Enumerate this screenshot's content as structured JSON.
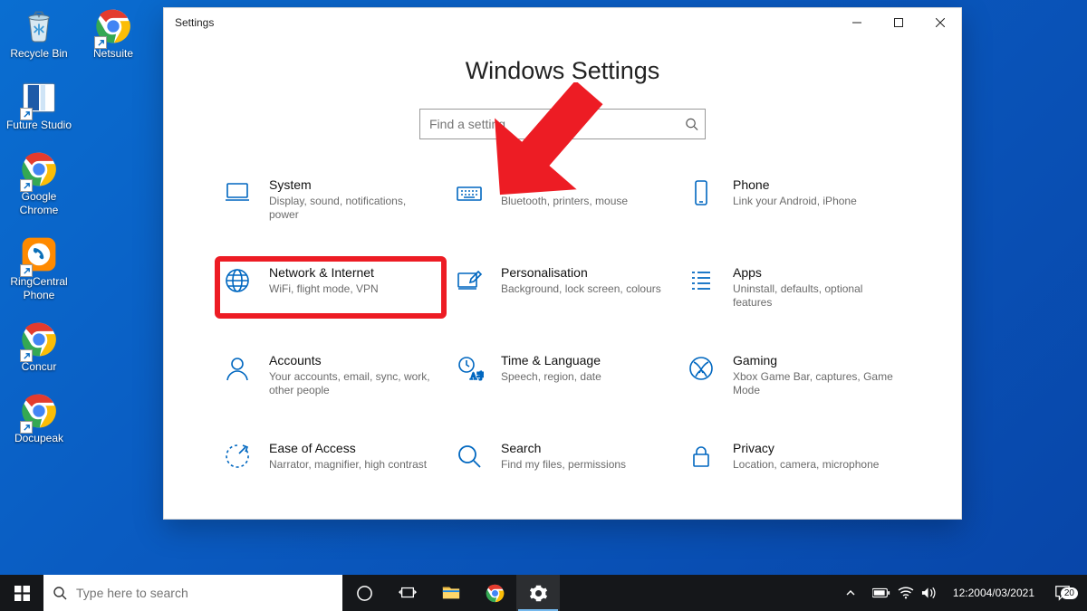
{
  "desktop": {
    "icons": [
      {
        "id": "recycle-bin",
        "label": "Recycle Bin"
      },
      {
        "id": "netsuite",
        "label": "Netsuite"
      },
      {
        "id": "future-studio",
        "label": "Future Studio"
      },
      {
        "id": "google-chrome",
        "label": "Google Chrome"
      },
      {
        "id": "ringcentral-phone",
        "label": "RingCentral Phone"
      },
      {
        "id": "concur",
        "label": "Concur"
      },
      {
        "id": "docupeak",
        "label": "Docupeak"
      }
    ]
  },
  "window": {
    "title": "Settings",
    "page_title": "Windows Settings",
    "search_placeholder": "Find a setting"
  },
  "categories": [
    {
      "id": "system",
      "title": "System",
      "sub": "Display, sound, notifications, power"
    },
    {
      "id": "devices",
      "title": "Devices",
      "sub": "Bluetooth, printers, mouse"
    },
    {
      "id": "phone",
      "title": "Phone",
      "sub": "Link your Android, iPhone"
    },
    {
      "id": "network",
      "title": "Network & Internet",
      "sub": "WiFi, flight mode, VPN"
    },
    {
      "id": "personalisation",
      "title": "Personalisation",
      "sub": "Background, lock screen, colours"
    },
    {
      "id": "apps",
      "title": "Apps",
      "sub": "Uninstall, defaults, optional features"
    },
    {
      "id": "accounts",
      "title": "Accounts",
      "sub": "Your accounts, email, sync, work, other people"
    },
    {
      "id": "time",
      "title": "Time & Language",
      "sub": "Speech, region, date"
    },
    {
      "id": "gaming",
      "title": "Gaming",
      "sub": "Xbox Game Bar, captures, Game Mode"
    },
    {
      "id": "ease",
      "title": "Ease of Access",
      "sub": "Narrator, magnifier, high contrast"
    },
    {
      "id": "search",
      "title": "Search",
      "sub": "Find my files, permissions"
    },
    {
      "id": "privacy",
      "title": "Privacy",
      "sub": "Location, camera, microphone"
    }
  ],
  "taskbar": {
    "search_placeholder": "Type here to search",
    "time": "12:20",
    "date": "04/03/2021",
    "action_center_badge": "20"
  }
}
